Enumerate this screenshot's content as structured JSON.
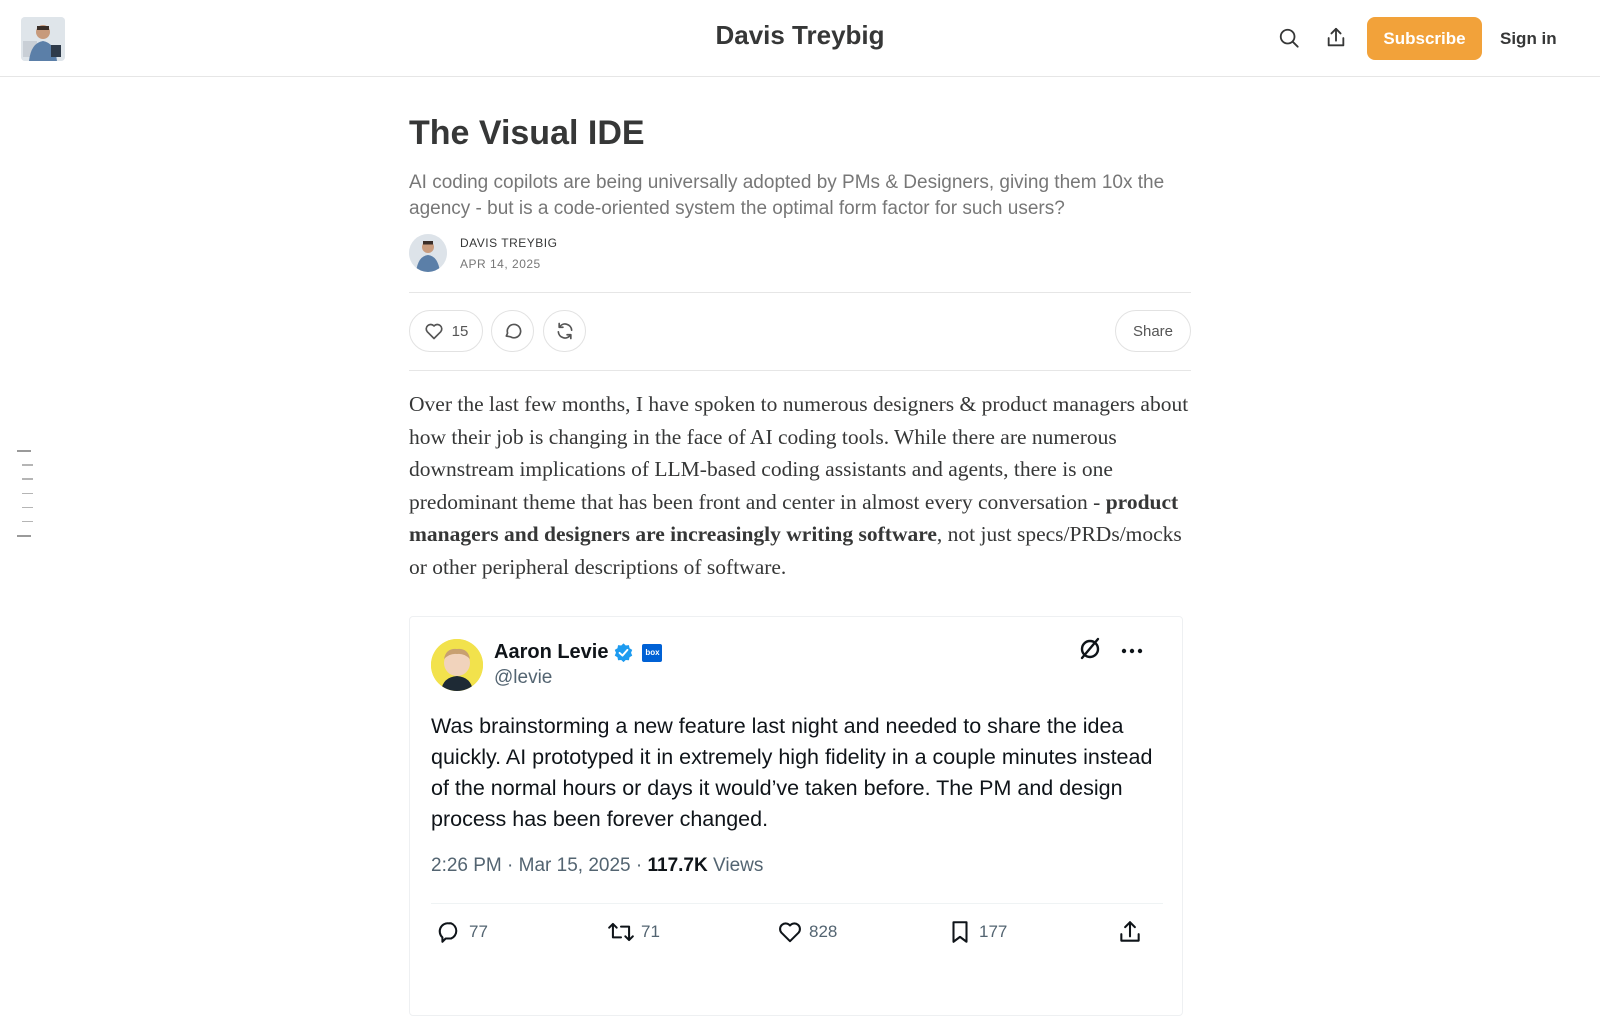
{
  "header": {
    "publication_title": "Davis Treybig",
    "subscribe_label": "Subscribe",
    "signin_label": "Sign in",
    "icons": [
      "search-icon",
      "share-upload-icon"
    ]
  },
  "colors": {
    "accent": "#f2a23a",
    "text": "#363737",
    "muted": "#777777",
    "tweet_verified": "#1d9bf0",
    "tweet_box_badge": "#0061d5"
  },
  "post": {
    "title": "The Visual IDE",
    "subtitle": "AI coding copilots are being universally adopted by PMs & Designers, giving them 10x the agency - but is a code-oriented system the optimal form factor for such users?",
    "author": "DAVIS TREYBIG",
    "date": "APR 14, 2025",
    "like_count": "15",
    "share_label": "Share",
    "body_intro": "Over the last few months, I have spoken to numerous designers & product managers about how their job is changing in the face of AI coding tools. While there are numerous downstream implications of LLM-based coding assistants and agents, there is one predominant theme that has been front and center in almost every conversation - ",
    "body_bold": "product managers and designers are increasingly writing software",
    "body_tail": ", not just specs/PRDs/mocks or other peripheral descriptions of software."
  },
  "tweet": {
    "name": "Aaron Levie",
    "badge_text": "box",
    "handle": "@levie",
    "text": "Was brainstorming a new feature last night and needed to share the idea quickly. AI prototyped it in extremely high fidelity in a couple minutes instead of the normal hours or days it would’ve taken before. The PM and design process has been forever changed.",
    "time": "2:26 PM · Mar 15, 2025 · ",
    "views_count": "117.7K",
    "views_label": " Views",
    "replies": "77",
    "retweets": "71",
    "likes": "828",
    "bookmarks": "177"
  }
}
